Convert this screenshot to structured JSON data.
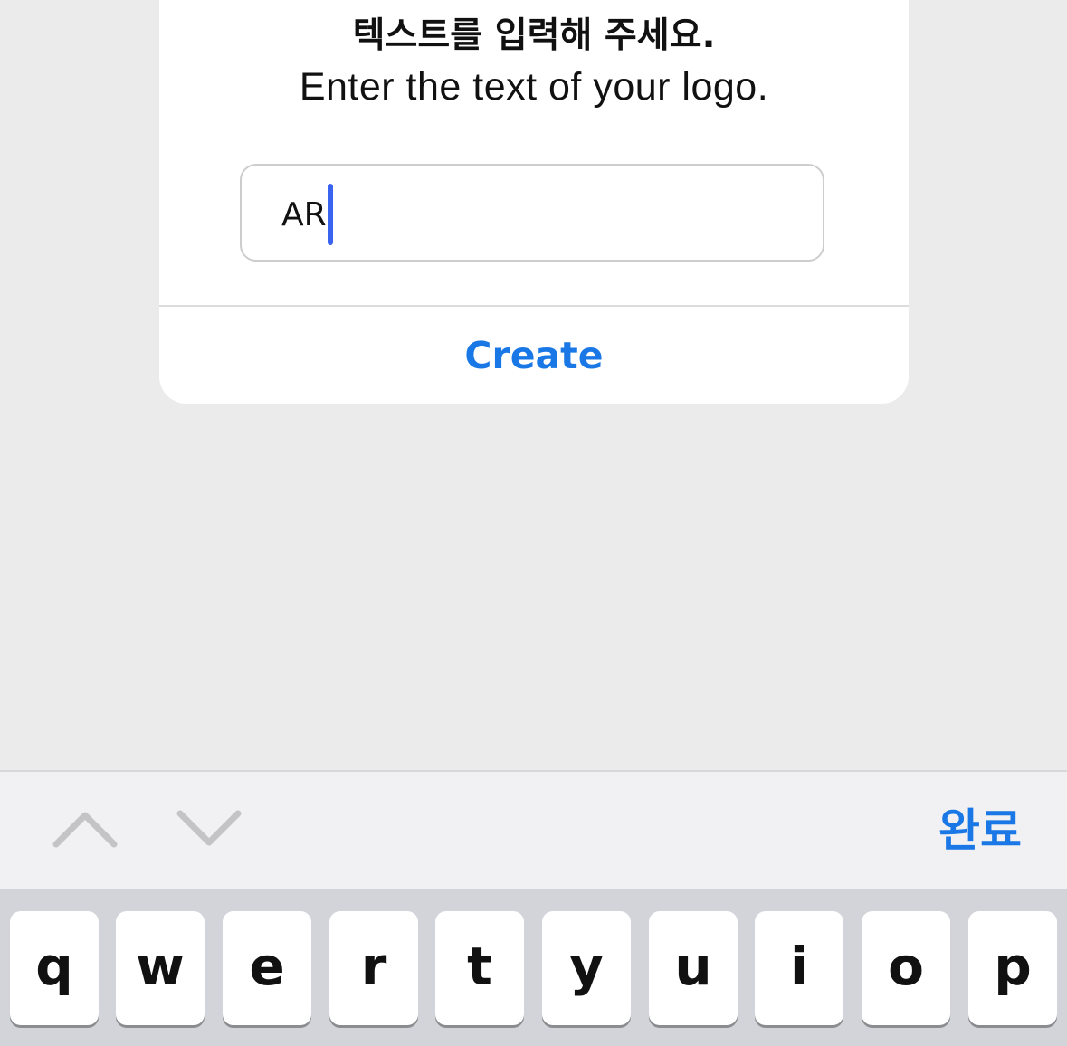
{
  "dialog": {
    "message_ko": "텍스트를 입력해 주세요.",
    "message_en": "Enter the text of your logo.",
    "input_value": "AR",
    "create_label": "Create"
  },
  "toolbar": {
    "previous_icon": "chevron-up-icon",
    "next_icon": "chevron-down-icon",
    "done_label": "완료"
  },
  "keyboard": {
    "row1": [
      "q",
      "w",
      "e",
      "r",
      "t",
      "y",
      "u",
      "i",
      "o",
      "p"
    ]
  },
  "colors": {
    "accent": "#1a78e6",
    "caret": "#3a63f0",
    "background": "#ebebec",
    "keyboard_bg": "#d2d4d9"
  }
}
